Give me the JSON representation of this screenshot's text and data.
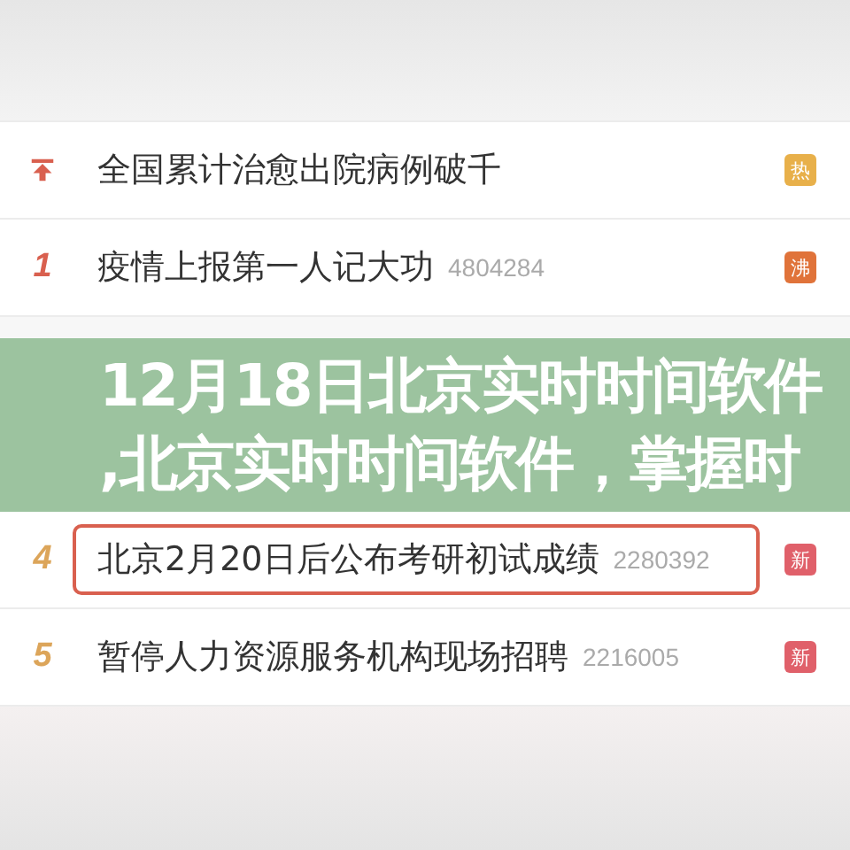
{
  "hot_list": [
    {
      "kind": "pinned",
      "title": "全国累计治愈出院病例破千",
      "badge": {
        "label": "热",
        "color": "#e8b04a"
      },
      "highlighted": false
    },
    {
      "kind": "ranked",
      "rank": "1",
      "title": "疫情上报第一人记大功",
      "count": "4804284",
      "badge": {
        "label": "沸",
        "color": "#e0733a"
      },
      "highlighted": false
    },
    {
      "kind": "banner",
      "lines": [
        "12月18日北京实时时间软件",
        ",北京实时时间软件，掌握时"
      ]
    },
    {
      "kind": "ranked",
      "rank": "4",
      "title": "北京2月20日后公布考研初试成绩",
      "count": "2280392",
      "badge": {
        "label": "新",
        "color": "#e0606a"
      },
      "highlighted": true
    },
    {
      "kind": "ranked",
      "rank": "5",
      "title": "暂停人力资源服务机构现场招聘",
      "count": "2216005",
      "badge": {
        "label": "新",
        "color": "#e0606a"
      },
      "highlighted": false
    }
  ]
}
